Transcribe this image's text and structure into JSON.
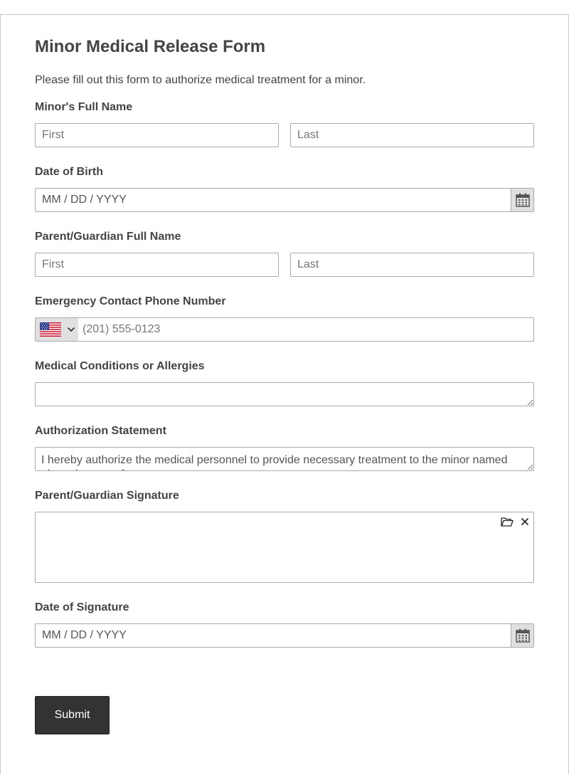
{
  "form": {
    "title": "Minor Medical Release Form",
    "subtitle": "Please fill out this form to authorize medical treatment for a minor.",
    "minor_name": {
      "label": "Minor's Full Name",
      "first_placeholder": "First",
      "last_placeholder": "Last"
    },
    "dob": {
      "label": "Date of Birth",
      "placeholder": "MM / DD / YYYY",
      "icon": "calendar-icon"
    },
    "guardian_name": {
      "label": "Parent/Guardian Full Name",
      "first_placeholder": "First",
      "last_placeholder": "Last"
    },
    "phone": {
      "label": "Emergency Contact Phone Number",
      "country_flag": "us-flag-icon",
      "placeholder": "(201) 555-0123"
    },
    "conditions": {
      "label": "Medical Conditions or Allergies",
      "value": ""
    },
    "authorization": {
      "label": "Authorization Statement",
      "value": "I hereby authorize the medical personnel to provide necessary treatment to the minor named above in case of emergency."
    },
    "signature": {
      "label": "Parent/Guardian Signature",
      "upload_icon": "folder-open-icon",
      "clear_icon": "close-icon"
    },
    "sig_date": {
      "label": "Date of Signature",
      "placeholder": "MM / DD / YYYY",
      "icon": "calendar-icon"
    },
    "submit_label": "Submit"
  },
  "colors": {
    "text": "#444444",
    "border": "#aaaaaa",
    "button_bg": "#333333",
    "addon_bg": "#e0e0e0"
  }
}
